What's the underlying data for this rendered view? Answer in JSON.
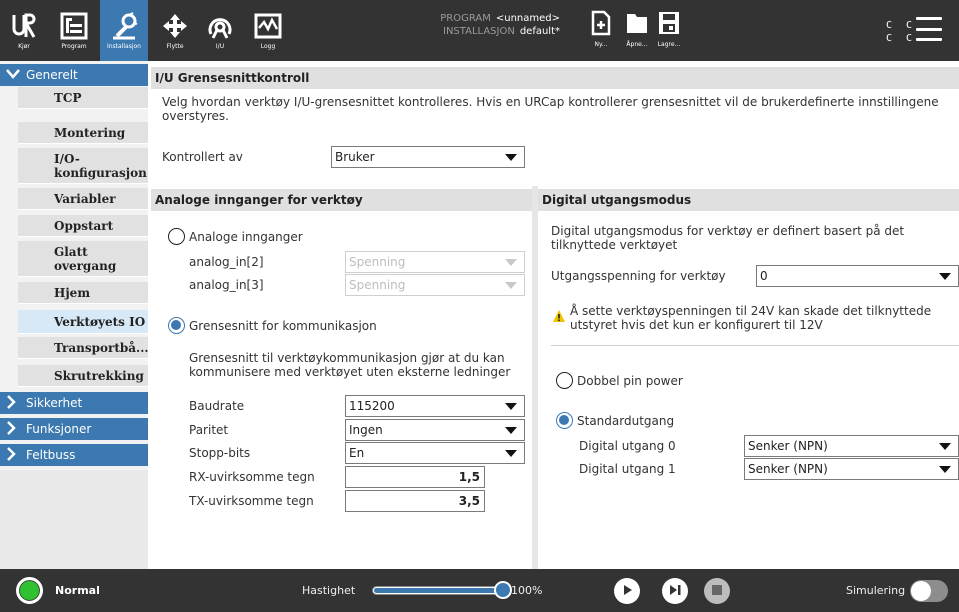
{
  "topbar": {
    "nav": [
      {
        "label": "Kjør",
        "icon": "ur-logo-icon"
      },
      {
        "label": "Program",
        "icon": "program-icon"
      },
      {
        "label": "Installasjon",
        "icon": "installation-icon"
      }
    ],
    "tools": [
      {
        "label": "Flytte",
        "icon": "move-icon"
      },
      {
        "label": "I/U",
        "icon": "io-icon"
      },
      {
        "label": "Logg",
        "icon": "log-icon"
      }
    ],
    "program_key": "PROGRAM",
    "program_value": "<unnamed>",
    "installation_key": "INSTALLASJON",
    "installation_value": "default*",
    "files": [
      {
        "label": "Ny...",
        "icon": "new-file-icon"
      },
      {
        "label": "Åpne...",
        "icon": "open-folder-icon"
      },
      {
        "label": "Lagre...",
        "icon": "save-icon"
      }
    ],
    "cc_row1": "C C",
    "cc_row2": "C C"
  },
  "sidebar": {
    "groups": [
      {
        "label": "Generelt",
        "expanded": true
      },
      {
        "label": "Sikkerhet",
        "expanded": false
      },
      {
        "label": "Funksjoner",
        "expanded": false
      },
      {
        "label": "Feltbuss",
        "expanded": false
      }
    ],
    "items": [
      {
        "label": "TCP"
      },
      {
        "label": "Montering"
      },
      {
        "label": "I/O-\nkonfigurasjon"
      },
      {
        "label": "Variabler"
      },
      {
        "label": "Oppstart"
      },
      {
        "label": "Glatt\novergang"
      },
      {
        "label": "Hjem"
      },
      {
        "label": "Verktøyets IO",
        "active": true
      },
      {
        "label": "Transportbå..."
      },
      {
        "label": "Skrutrekking"
      }
    ]
  },
  "main": {
    "header": "I/U Grensesnittkontroll",
    "description": "Velg hvordan verktøy I/U-grensesnittet kontrolleres. Hvis en URCap kontrollerer grensesnittet vil de brukerdefinerte innstillingene overstyres.",
    "controlled_by_label": "Kontrollert av",
    "controlled_by_value": "Bruker"
  },
  "analog": {
    "header": "Analoge innganger for verktøy",
    "radio_analog_label": "Analoge innganger",
    "in2_label": "analog_in[2]",
    "in2_value": "Spenning",
    "in3_label": "analog_in[3]",
    "in3_value": "Spenning",
    "radio_comm_label": "Grensesnitt for kommunikasjon",
    "comm_description": "Grensesnitt til verktøykommunikasjon gjør at du kan kommunisere med verktøyet uten eksterne ledninger",
    "baud_label": "Baudrate",
    "baud_value": "115200",
    "parity_label": "Paritet",
    "parity_value": "Ingen",
    "stopbits_label": "Stopp-bits",
    "stopbits_value": "En",
    "rx_label": "RX-uvirksomme tegn",
    "rx_value": "1,5",
    "tx_label": "TX-uvirksomme tegn",
    "tx_value": "3,5"
  },
  "digital": {
    "header": "Digital utgangsmodus",
    "description": "Digital utgangsmodus for verktøy er definert basert på det tilknyttede verktøyet",
    "voltage_label": "Utgangsspenning for verktøy",
    "voltage_value": "0",
    "warning": "Å sette verktøyspenningen til 24V kan skade det tilknyttede utstyret hvis det kun er konfigurert til 12V",
    "dual_pin_label": "Dobbel pin power",
    "standard_label": "Standardutgang",
    "out0_label": "Digital utgang 0",
    "out0_value": "Senker (NPN)",
    "out1_label": "Digital utgang 1",
    "out1_value": "Senker (NPN)"
  },
  "bottombar": {
    "status": "Normal",
    "speed_label": "Hastighet",
    "speed_value": "100%",
    "speed_fraction": 1.0,
    "sim_label": "Simulering"
  },
  "colors": {
    "accent": "#3b79b0",
    "bar": "#333333",
    "status_ok": "#2fc12f",
    "warning": "#f2c200"
  }
}
